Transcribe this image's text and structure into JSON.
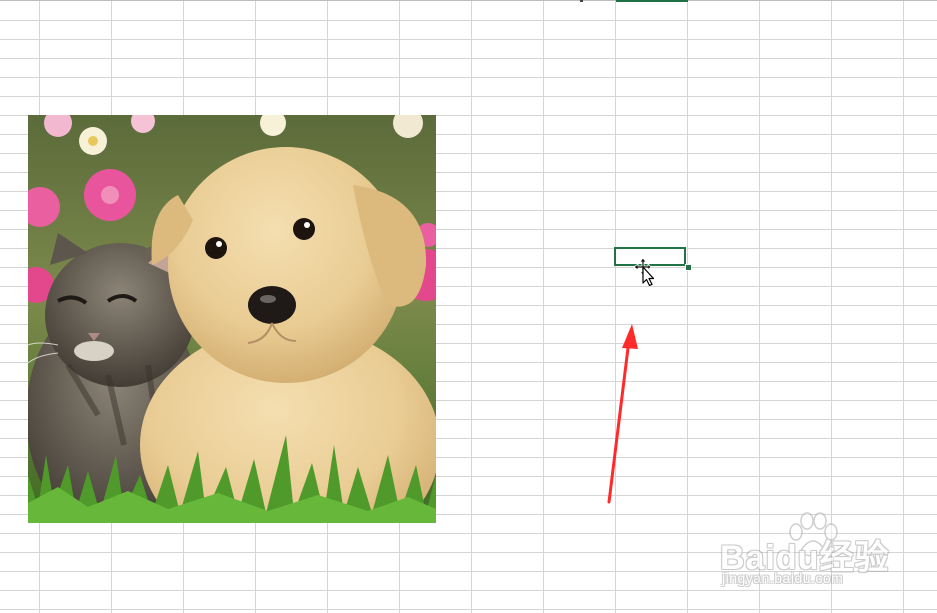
{
  "spreadsheet": {
    "active_cell_selected": true,
    "picture": {
      "subject": "kitten and puppy photo"
    },
    "accent_color": "#217346",
    "gridline_color": "#d4d4d4",
    "annotation_arrow_color": "#ff2b2b",
    "cursor": "move-cursor-icon"
  },
  "watermark": {
    "brand": "Baidu经验",
    "url": "jingyan.baidu.com"
  }
}
